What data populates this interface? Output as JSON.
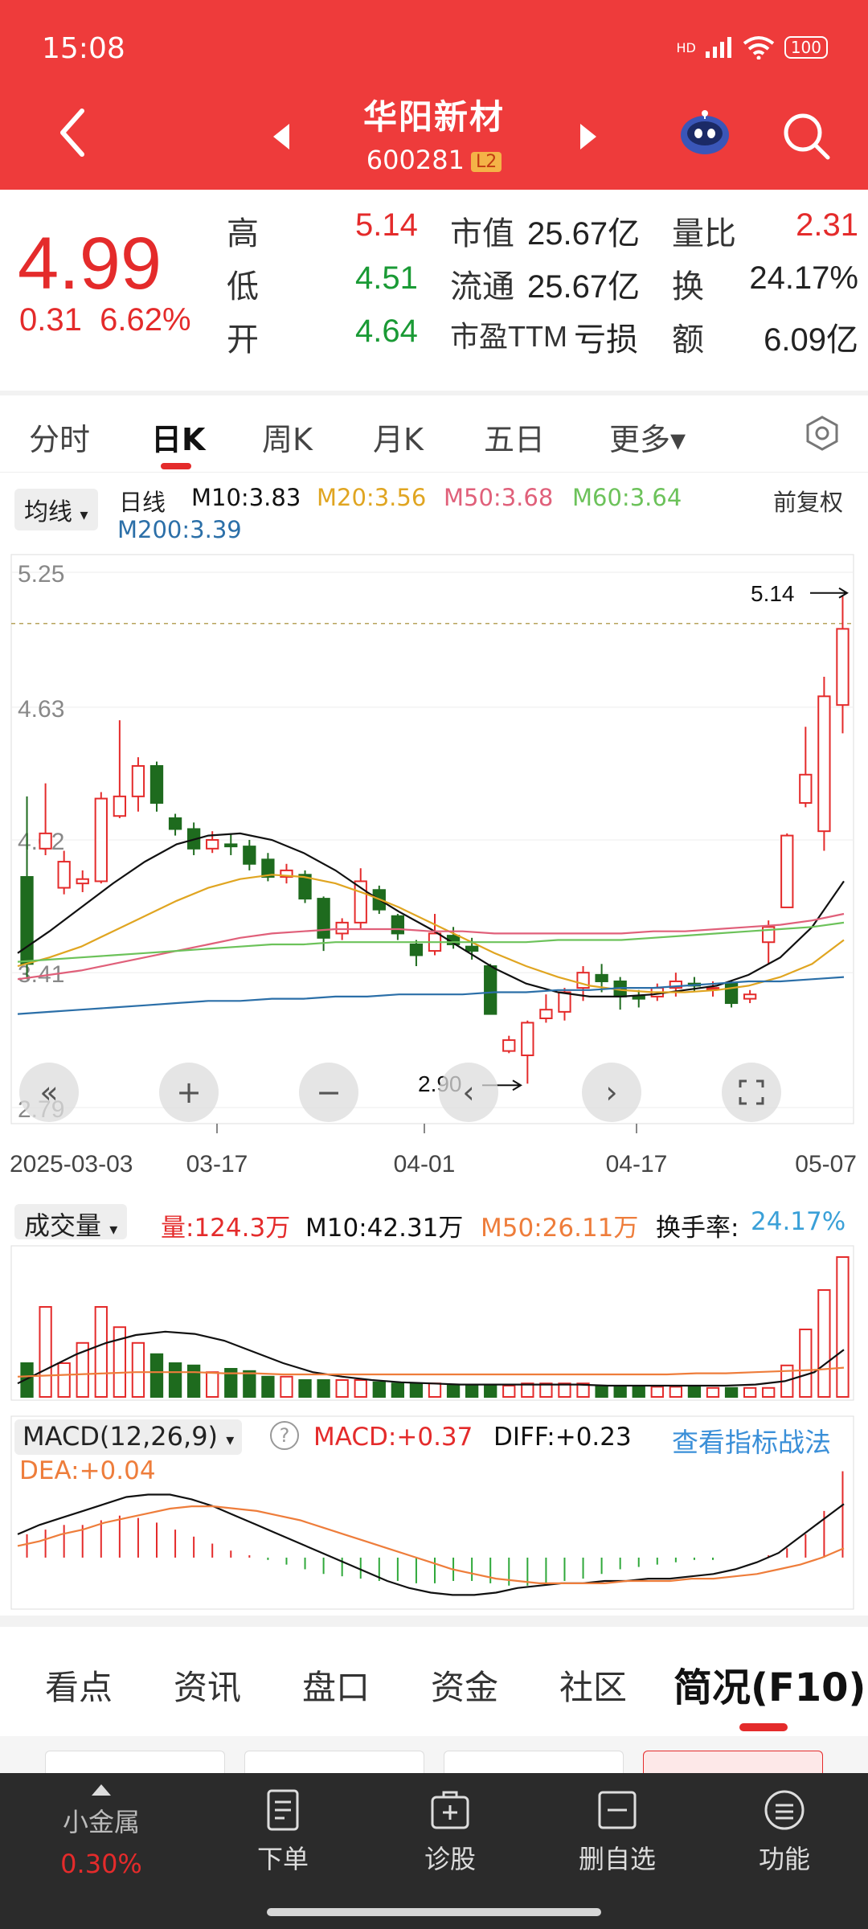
{
  "status_bar": {
    "time": "15:08",
    "network": "HD",
    "battery": "100"
  },
  "header": {
    "name": "华阳新材",
    "code": "600281",
    "badge": "L2"
  },
  "quote": {
    "price": "4.99",
    "change": "0.31",
    "change_pct": "6.62%",
    "rows": [
      {
        "l1": "高",
        "v1": "5.14",
        "l2": "市值",
        "v2": "25.67亿",
        "l3": "量比",
        "v3": "2.31"
      },
      {
        "l1": "低",
        "v1": "4.51",
        "l2": "流通",
        "v2": "25.67亿",
        "l3": "换",
        "v3": "24.17%"
      },
      {
        "l1": "开",
        "v1": "4.64",
        "l2": "市盈TTM",
        "v2": "亏损",
        "l3": "额",
        "v3": "6.09亿"
      }
    ]
  },
  "k_tabs": [
    "分时",
    "日K",
    "周K",
    "月K",
    "五日",
    "更多▾"
  ],
  "ma_bar": {
    "selector": "均线",
    "period": "日线",
    "m10": "M10:3.83",
    "m20": "M20:3.56",
    "m50": "M50:3.68",
    "m60": "M60:3.64",
    "m200": "M200:3.39",
    "adjust": "前复权"
  },
  "colors": {
    "up": "#e42b2b",
    "down": "#1e6b1e",
    "m10": "#111111",
    "m20": "#e0a521",
    "m50": "#e0607a",
    "m60": "#6cc25a",
    "m200": "#2b6fa8",
    "vol_m50": "#ee7d3b",
    "diff": "#111111",
    "dea": "#ee7d3b",
    "header_bg": "#ee3b3b"
  },
  "chart_data": {
    "type": "candlestick",
    "y_ticks": [
      "5.25",
      "4.63",
      "4.02",
      "3.41",
      "2.79"
    ],
    "ylim": [
      2.79,
      5.25
    ],
    "x_labels": [
      "2025-03-03",
      "03-17",
      "04-01",
      "04-17",
      "05-07"
    ],
    "high_marker": "5.14",
    "low_marker": "2.90",
    "candles": [
      [
        3.85,
        3.45,
        4.22,
        3.38
      ],
      [
        3.98,
        4.05,
        4.28,
        3.95
      ],
      [
        3.8,
        3.92,
        3.97,
        3.77
      ],
      [
        3.82,
        3.84,
        3.88,
        3.78
      ],
      [
        3.83,
        4.21,
        4.24,
        3.82
      ],
      [
        4.13,
        4.22,
        4.57,
        4.12
      ],
      [
        4.22,
        4.36,
        4.4,
        4.15
      ],
      [
        4.36,
        4.19,
        4.38,
        4.15
      ],
      [
        4.12,
        4.07,
        4.14,
        4.04
      ],
      [
        4.07,
        3.98,
        4.1,
        3.95
      ],
      [
        3.98,
        4.02,
        4.06,
        3.96
      ],
      [
        4.0,
        3.99,
        4.05,
        3.95
      ],
      [
        3.99,
        3.91,
        4.02,
        3.88
      ],
      [
        3.93,
        3.85,
        3.96,
        3.83
      ],
      [
        3.85,
        3.88,
        3.91,
        3.82
      ],
      [
        3.86,
        3.75,
        3.88,
        3.73
      ],
      [
        3.75,
        3.57,
        3.76,
        3.51
      ],
      [
        3.59,
        3.64,
        3.66,
        3.56
      ],
      [
        3.64,
        3.83,
        3.89,
        3.61
      ],
      [
        3.79,
        3.7,
        3.81,
        3.68
      ],
      [
        3.67,
        3.59,
        3.68,
        3.56
      ],
      [
        3.54,
        3.49,
        3.56,
        3.44
      ],
      [
        3.51,
        3.59,
        3.68,
        3.49
      ],
      [
        3.58,
        3.54,
        3.62,
        3.52
      ],
      [
        3.53,
        3.51,
        3.57,
        3.47
      ],
      [
        3.44,
        3.22,
        3.45,
        3.22
      ],
      [
        3.05,
        3.1,
        3.12,
        3.04
      ],
      [
        3.03,
        3.18,
        3.19,
        2.9
      ],
      [
        3.2,
        3.24,
        3.31,
        3.18
      ],
      [
        3.23,
        3.32,
        3.34,
        3.19
      ],
      [
        3.34,
        3.41,
        3.44,
        3.28
      ],
      [
        3.4,
        3.37,
        3.45,
        3.32
      ],
      [
        3.37,
        3.3,
        3.39,
        3.24
      ],
      [
        3.3,
        3.29,
        3.33,
        3.25
      ],
      [
        3.3,
        3.34,
        3.36,
        3.28
      ],
      [
        3.34,
        3.37,
        3.41,
        3.3
      ],
      [
        3.36,
        3.35,
        3.39,
        3.32
      ],
      [
        3.34,
        3.34,
        3.37,
        3.3
      ],
      [
        3.36,
        3.27,
        3.37,
        3.25
      ],
      [
        3.29,
        3.31,
        3.33,
        3.27
      ],
      [
        3.55,
        3.62,
        3.65,
        3.45
      ],
      [
        3.71,
        4.04,
        4.05,
        3.71
      ],
      [
        4.19,
        4.32,
        4.54,
        4.17
      ],
      [
        4.06,
        4.68,
        4.77,
        3.97
      ],
      [
        4.64,
        4.99,
        5.14,
        4.51
      ]
    ],
    "ma": {
      "M10": [
        3.5,
        3.6,
        3.71,
        3.82,
        3.92,
        4.0,
        4.04,
        4.05,
        4.02,
        3.96,
        3.88,
        3.78,
        3.69,
        3.61,
        3.52,
        3.43,
        3.36,
        3.32,
        3.3,
        3.3,
        3.31,
        3.33,
        3.35,
        3.4,
        3.48,
        3.62,
        3.83
      ],
      "M20": [
        3.44,
        3.48,
        3.53,
        3.6,
        3.67,
        3.74,
        3.8,
        3.84,
        3.86,
        3.85,
        3.82,
        3.77,
        3.71,
        3.64,
        3.57,
        3.5,
        3.44,
        3.39,
        3.35,
        3.33,
        3.32,
        3.32,
        3.33,
        3.35,
        3.39,
        3.45,
        3.56
      ],
      "M50": [
        3.38,
        3.4,
        3.42,
        3.45,
        3.48,
        3.51,
        3.54,
        3.57,
        3.59,
        3.6,
        3.61,
        3.61,
        3.61,
        3.6,
        3.6,
        3.59,
        3.59,
        3.59,
        3.59,
        3.59,
        3.6,
        3.6,
        3.61,
        3.62,
        3.63,
        3.65,
        3.68
      ],
      "M60": [
        3.46,
        3.47,
        3.48,
        3.49,
        3.5,
        3.51,
        3.52,
        3.53,
        3.54,
        3.54,
        3.55,
        3.55,
        3.55,
        3.55,
        3.55,
        3.55,
        3.55,
        3.56,
        3.56,
        3.56,
        3.57,
        3.58,
        3.59,
        3.6,
        3.61,
        3.62,
        3.64
      ],
      "M200": [
        3.22,
        3.23,
        3.24,
        3.25,
        3.26,
        3.27,
        3.28,
        3.28,
        3.29,
        3.29,
        3.3,
        3.3,
        3.31,
        3.31,
        3.31,
        3.32,
        3.32,
        3.33,
        3.33,
        3.34,
        3.34,
        3.35,
        3.36,
        3.37,
        3.37,
        3.38,
        3.39
      ]
    }
  },
  "volume": {
    "label": "成交量",
    "vol": "量:124.3万",
    "m10": "M10:42.31万",
    "m50": "M50:26.11万",
    "turnover_label": "换手率:",
    "turnover": "24.17%",
    "bars": [
      30,
      80,
      30,
      48,
      80,
      62,
      48,
      38,
      30,
      28,
      22,
      25,
      23,
      18,
      18,
      15,
      15,
      15,
      15,
      13,
      12,
      12,
      12,
      11,
      11,
      10,
      10,
      12,
      12,
      12,
      12,
      10,
      10,
      9,
      9,
      9,
      9,
      8,
      8,
      8,
      8,
      28,
      60,
      95,
      124.3
    ],
    "m10_line": [
      12,
      25,
      38,
      48,
      55,
      58,
      56,
      50,
      40,
      30,
      22,
      18,
      15,
      13,
      12,
      11,
      11,
      11,
      11,
      11,
      10,
      10,
      10,
      10,
      10,
      11,
      14,
      22,
      42
    ],
    "m50_line": [
      18,
      19,
      20,
      21,
      22,
      22,
      22,
      21,
      21,
      20,
      20,
      20,
      20,
      20,
      20,
      20,
      20,
      20,
      20,
      20,
      20,
      20,
      20,
      21,
      21,
      22,
      23,
      24,
      26
    ]
  },
  "macd": {
    "label": "MACD(12,26,9)",
    "macd_value": "MACD:+0.37",
    "diff_value": "DIFF:+0.23",
    "link": "查看指标战法",
    "dea_value": "DEA:+0.04",
    "hist": [
      0.1,
      0.12,
      0.14,
      0.14,
      0.16,
      0.18,
      0.17,
      0.15,
      0.12,
      0.09,
      0.06,
      0.03,
      0.01,
      -0.01,
      -0.03,
      -0.05,
      -0.07,
      -0.08,
      -0.09,
      -0.1,
      -0.1,
      -0.11,
      -0.11,
      -0.1,
      -0.1,
      -0.11,
      -0.12,
      -0.12,
      -0.11,
      -0.1,
      -0.09,
      -0.07,
      -0.05,
      -0.04,
      -0.03,
      -0.02,
      -0.01,
      -0.01,
      0.0,
      0.0,
      0.01,
      0.04,
      0.1,
      0.2,
      0.37
    ],
    "diff": [
      0.1,
      0.14,
      0.17,
      0.2,
      0.23,
      0.26,
      0.27,
      0.27,
      0.25,
      0.22,
      0.18,
      0.14,
      0.1,
      0.06,
      0.02,
      -0.02,
      -0.06,
      -0.1,
      -0.13,
      -0.15,
      -0.16,
      -0.16,
      -0.15,
      -0.13,
      -0.12,
      -0.11,
      -0.11,
      -0.1,
      -0.1,
      -0.09,
      -0.09,
      -0.08,
      -0.07,
      -0.05,
      -0.02,
      0.02,
      0.09,
      0.16,
      0.23
    ],
    "dea": [
      0.05,
      0.07,
      0.1,
      0.12,
      0.15,
      0.17,
      0.19,
      0.21,
      0.22,
      0.22,
      0.21,
      0.2,
      0.18,
      0.16,
      0.13,
      0.1,
      0.07,
      0.04,
      0.01,
      -0.02,
      -0.05,
      -0.07,
      -0.09,
      -0.1,
      -0.11,
      -0.11,
      -0.11,
      -0.11,
      -0.1,
      -0.1,
      -0.1,
      -0.09,
      -0.09,
      -0.08,
      -0.07,
      -0.05,
      -0.03,
      0.0,
      0.04
    ]
  },
  "info_tabs": [
    "看点",
    "资讯",
    "盘口",
    "资金",
    "社区",
    "简况(F10)"
  ],
  "bottom_nav": {
    "market": "小金属",
    "market_change": "0.30%",
    "items": [
      "下单",
      "诊股",
      "删自选",
      "功能"
    ]
  }
}
